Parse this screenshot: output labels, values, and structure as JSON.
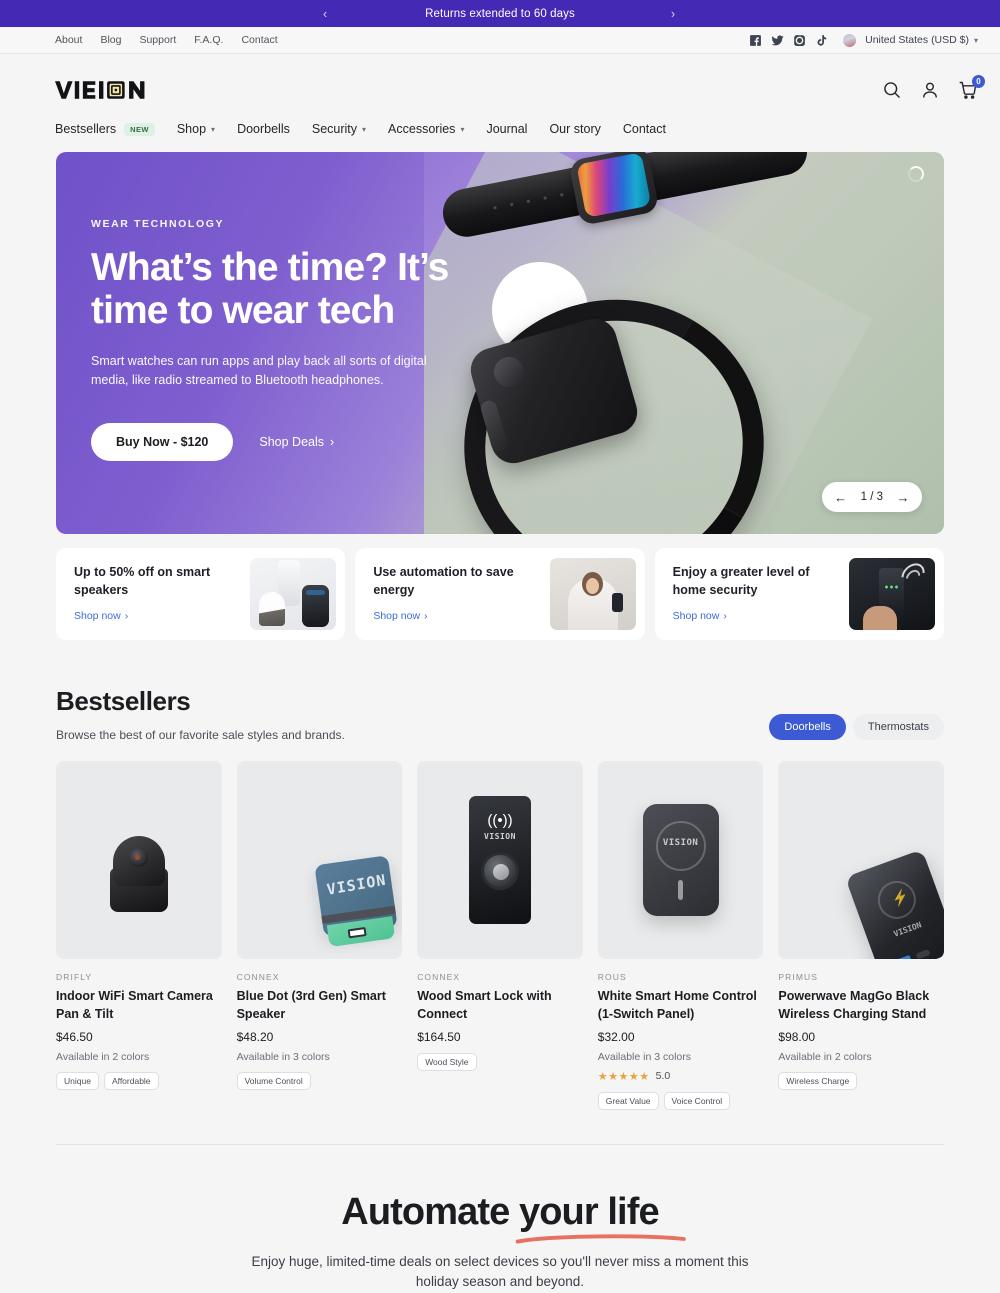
{
  "announcement": {
    "text": "Returns extended to 60 days",
    "prev_icon": "chevron-left-icon",
    "next_icon": "chevron-right-icon"
  },
  "utility": {
    "links": [
      "About",
      "Blog",
      "Support",
      "F.A.Q.",
      "Contact"
    ],
    "social": [
      "facebook-icon",
      "twitter-icon",
      "instagram-icon",
      "tiktok-icon"
    ],
    "locale": "United States (USD $)"
  },
  "header": {
    "logo_text": "VISION",
    "icons": [
      "search-icon",
      "account-icon",
      "cart-icon"
    ],
    "cart_count": "0",
    "nav": [
      {
        "label": "Bestsellers",
        "badge": "NEW",
        "caret": false
      },
      {
        "label": "Shop",
        "badge": "",
        "caret": true
      },
      {
        "label": "Doorbells",
        "badge": "",
        "caret": false
      },
      {
        "label": "Security",
        "badge": "",
        "caret": true
      },
      {
        "label": "Accessories",
        "badge": "",
        "caret": true
      },
      {
        "label": "Journal",
        "badge": "",
        "caret": false
      },
      {
        "label": "Our story",
        "badge": "",
        "caret": false
      },
      {
        "label": "Contact",
        "badge": "",
        "caret": false
      }
    ]
  },
  "hero": {
    "eyebrow": "WEAR TECHNOLOGY",
    "title": "What’s the time? It’s time to wear tech",
    "subtitle": "Smart watches can run apps and play back all sorts of digital media, like radio streamed to Bluetooth headphones.",
    "primary_button": "Buy Now - $120",
    "secondary_link": "Shop Deals",
    "slide_counter": "1 / 3",
    "prev_label": "←",
    "next_label": "→",
    "accent_color": "#7f5fcf"
  },
  "promos": [
    {
      "title": "Up to 50% off on smart speakers",
      "link": "Shop now",
      "image": "smart-speakers-photo"
    },
    {
      "title": "Use automation to save energy",
      "link": "Shop now",
      "image": "home-automation-photo"
    },
    {
      "title": "Enjoy a greater level of home security",
      "link": "Shop now",
      "image": "home-security-photo"
    }
  ],
  "bestsellers": {
    "title": "Bestsellers",
    "subtitle": "Browse the best of our favorite sale styles and brands.",
    "filters": [
      {
        "label": "Doorbells",
        "active": true
      },
      {
        "label": "Thermostats",
        "active": false
      }
    ],
    "products": [
      {
        "brand": "DRIFLY",
        "name": "Indoor WiFi Smart Camera Pan & Tilt",
        "price": "$46.50",
        "colors": "Available in 2 colors",
        "rating": "",
        "stars": "",
        "tags": [
          "Unique",
          "Affordable"
        ],
        "image": "indoor-camera-photo"
      },
      {
        "brand": "CONNEX",
        "name": "Blue Dot (3rd Gen) Smart Speaker",
        "price": "$48.20",
        "colors": "Available in 3 colors",
        "rating": "",
        "stars": "",
        "tags": [
          "Volume Control"
        ],
        "image": "blue-dot-speaker-photo"
      },
      {
        "brand": "CONNEX",
        "name": "Wood Smart Lock with Connect",
        "price": "$164.50",
        "colors": "",
        "rating": "",
        "stars": "",
        "tags": [
          "Wood Style"
        ],
        "image": "smart-lock-photo"
      },
      {
        "brand": "ROUS",
        "name": "White Smart Home Control (1-Switch Panel)",
        "price": "$32.00",
        "colors": "Available in 3 colors",
        "rating": "5.0",
        "stars": "★★★★★",
        "tags": [
          "Great Value",
          "Voice Control"
        ],
        "image": "smart-home-control-photo"
      },
      {
        "brand": "PRIMUS",
        "name": "Powerwave MagGo Black Wireless Charging Stand",
        "price": "$98.00",
        "colors": "Available in 2 colors",
        "rating": "",
        "stars": "",
        "tags": [
          "Wireless Charge"
        ],
        "image": "power-bank-photo"
      }
    ]
  },
  "automate": {
    "title_plain": "Automate ",
    "title_underlined": "your life",
    "underline_color": "#e8705f",
    "subtitle": "Enjoy huge, limited-time deals on select devices so you'll never miss a moment this holiday season and beyond."
  }
}
